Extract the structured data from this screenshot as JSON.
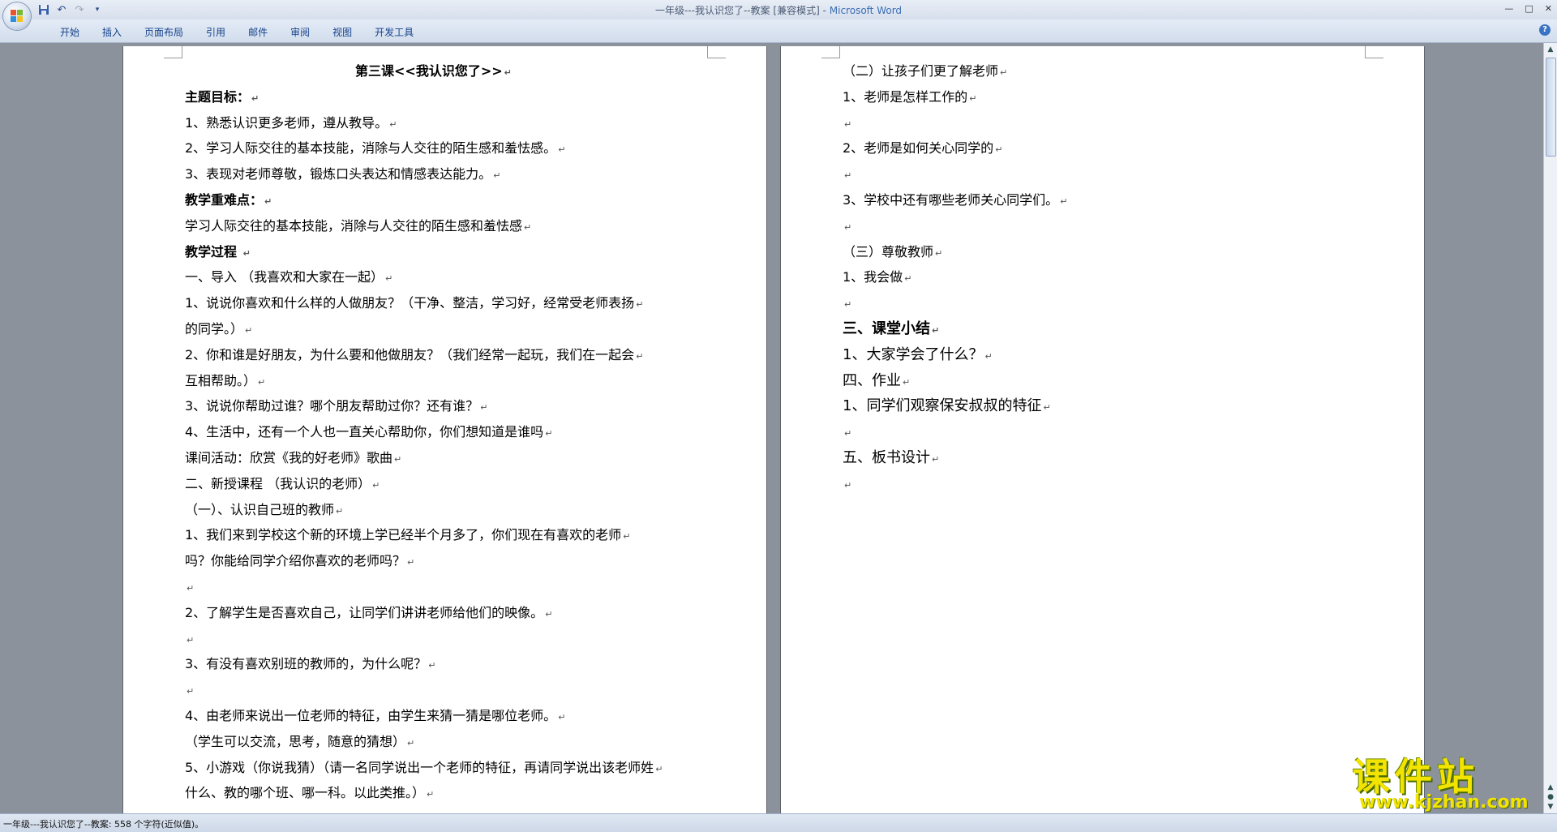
{
  "window": {
    "title_doc": "一年级---我认识您了--教案 [兼容模式]",
    "title_sep": " - ",
    "title_app": "Microsoft Word",
    "controls": [
      "—",
      "□",
      "✕"
    ]
  },
  "quick_access": {
    "icons": [
      "save-icon",
      "undo-icon",
      "redo-icon",
      "customize-icon"
    ]
  },
  "ribbon": {
    "tabs": [
      "开始",
      "插入",
      "页面布局",
      "引用",
      "邮件",
      "审阅",
      "视图",
      "开发工具"
    ]
  },
  "pages": {
    "left": [
      {
        "text": "第三课<<我认识您了>>",
        "bold": true
      },
      {
        "text": " 主题目标：",
        "bold": true
      },
      {
        "text": "1、熟悉认识更多老师，遵从教导。"
      },
      {
        "text": "2、学习人际交往的基本技能，消除与人交往的陌生感和羞怯感。"
      },
      {
        "text": " 3、表现对老师尊敬，锻炼口头表达和情感表达能力。"
      },
      {
        "text": "教学重难点：",
        "bold": true
      },
      {
        "text": "学习人际交往的基本技能，消除与人交往的陌生感和羞怯感"
      },
      {
        "text": "教学过程    ",
        "bold": true
      },
      {
        "text": "一、导入       （我喜欢和大家在一起）"
      },
      {
        "text": " 1、说说你喜欢和什么样的人做朋友？（干净、整洁，学习好，经常受老师表扬"
      },
      {
        "text": "的同学。）"
      },
      {
        "text": " 2、你和谁是好朋友，为什么要和他做朋友？（我们经常一起玩，我们在一起会"
      },
      {
        "text": "互相帮助。）"
      },
      {
        "text": " 3、说说你帮助过谁？哪个朋友帮助过你？还有谁？"
      },
      {
        "text": "4、生活中，还有一个人也一直关心帮助你，你们想知道是谁吗"
      },
      {
        "text": "课间活动：欣赏《我的好老师》歌曲"
      },
      {
        "text": "二、新授课程       （我认识的老师）"
      },
      {
        "text": "（一）、认识自己班的教师"
      },
      {
        "text": " 1、我们来到学校这个新的环境上学已经半个月多了，你们现在有喜欢的老师"
      },
      {
        "text": "吗？你能给同学介绍你喜欢的老师吗？"
      },
      {
        "text": ""
      },
      {
        "text": "2、了解学生是否喜欢自己，让同学们讲讲老师给他们的映像。"
      },
      {
        "text": ""
      },
      {
        "text": "3、有没有喜欢别班的教师的，为什么呢？"
      },
      {
        "text": ""
      },
      {
        "text": "4、由老师来说出一位老师的特征，由学生来猜一猜是哪位老师。"
      },
      {
        "text": "（学生可以交流，思考，随意的猜想）"
      },
      {
        "text": "5、小游戏（你说我猜）（请一名同学说出一个老师的特征，再请同学说出该老师姓"
      },
      {
        "text": "什么、教的哪个班、哪一科。以此类推。）"
      }
    ],
    "right": [
      {
        "text": "（二）让孩子们更了解老师"
      },
      {
        "text": "1、老师是怎样工作的"
      },
      {
        "text": ""
      },
      {
        "text": " 2、老师是如何关心同学的"
      },
      {
        "text": ""
      },
      {
        "text": " 3、学校中还有哪些老师关心同学们。"
      },
      {
        "text": ""
      },
      {
        "text": "（三）尊敬教师"
      },
      {
        "text": "1、我会做"
      },
      {
        "text": ""
      },
      {
        "text": "三、课堂小结",
        "bold": true,
        "big": true
      },
      {
        "text": "1、大家学会了什么？",
        "big": true
      },
      {
        "text": "四、作业",
        "big": true
      },
      {
        "text": "1、同学们观察保安叔叔的特征",
        "big": true
      },
      {
        "text": ""
      },
      {
        "text": "五、板书设计",
        "big": true
      },
      {
        "text": ""
      }
    ],
    "paragraph_mark": "↵"
  },
  "status": {
    "text": "一年级---我认识您了--教案: 558 个字符(近似值)。"
  },
  "watermark": {
    "title": "课件站",
    "url": "www.kjzhan.com"
  }
}
